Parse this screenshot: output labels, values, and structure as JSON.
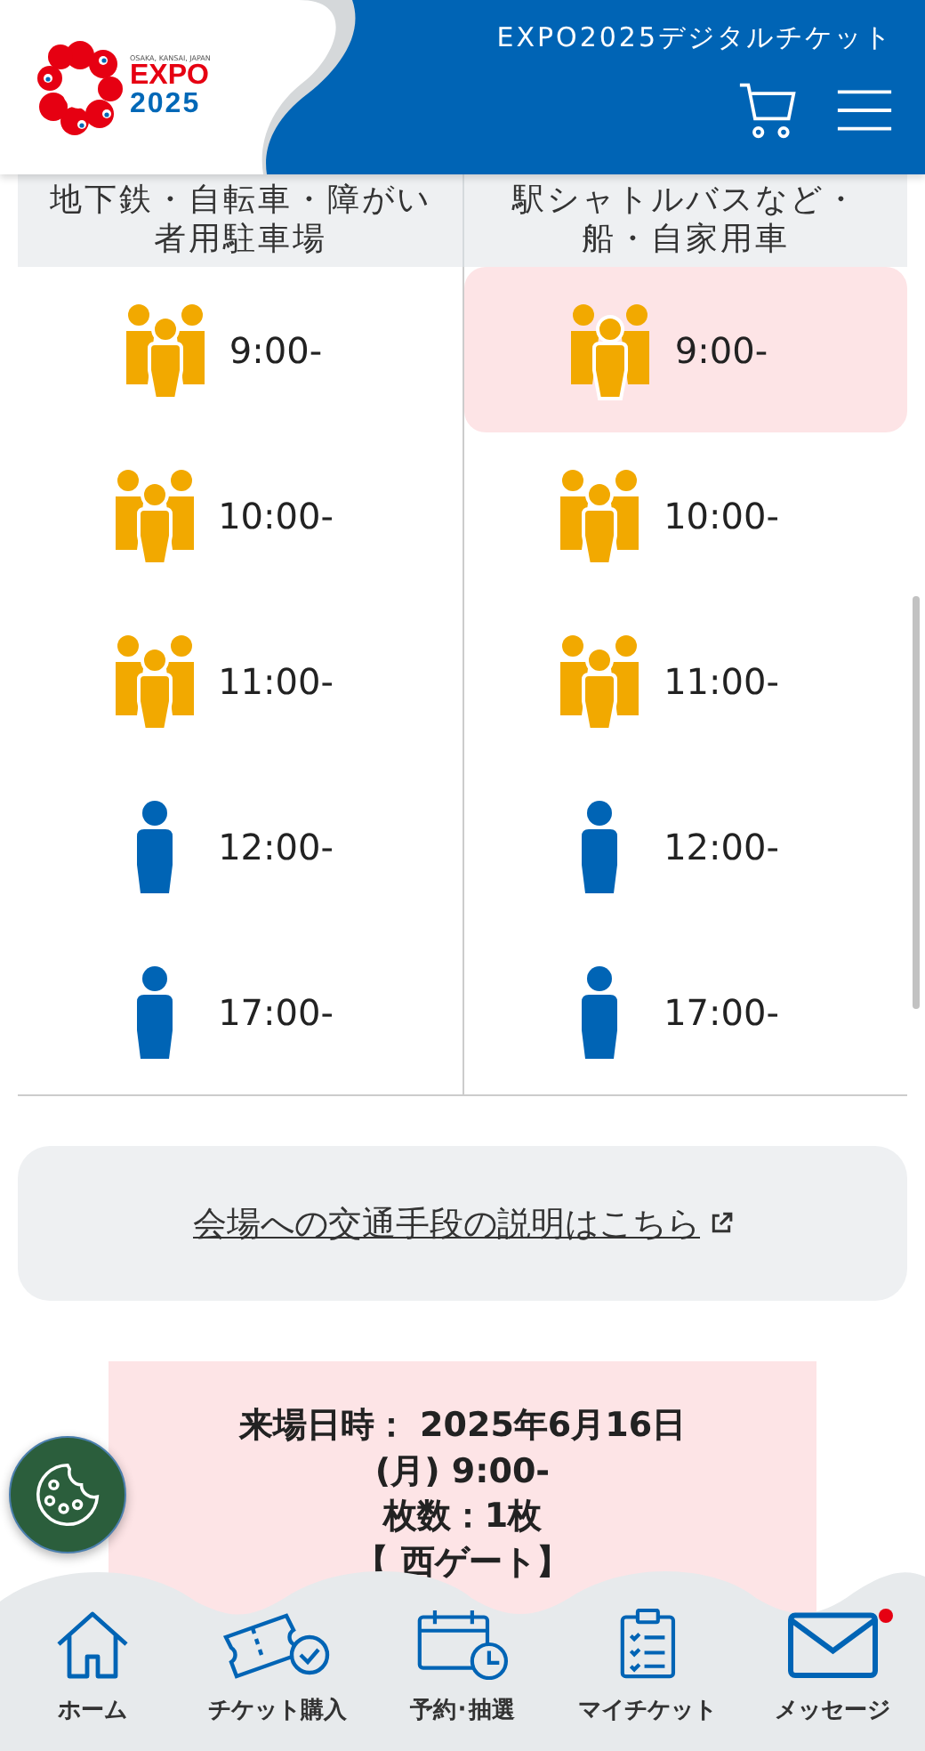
{
  "header": {
    "logo": {
      "tagline": "OSAKA, KANSAI, JAPAN",
      "word": "EXPO",
      "year": "2025"
    },
    "title": "EXPO2025デジタルチケット"
  },
  "table": {
    "columns": [
      "地下鉄・自転車・障がい者用駐車場",
      "駅シャトルバスなど・船・自家用車"
    ],
    "rows": [
      [
        {
          "time": "9:00-",
          "kind": "crowded",
          "selected": false
        },
        {
          "time": "9:00-",
          "kind": "crowded",
          "selected": true
        }
      ],
      [
        {
          "time": "10:00-",
          "kind": "crowded",
          "selected": false
        },
        {
          "time": "10:00-",
          "kind": "crowded",
          "selected": false
        }
      ],
      [
        {
          "time": "11:00-",
          "kind": "crowded",
          "selected": false
        },
        {
          "time": "11:00-",
          "kind": "crowded",
          "selected": false
        }
      ],
      [
        {
          "time": "12:00-",
          "kind": "few",
          "selected": false
        },
        {
          "time": "12:00-",
          "kind": "few",
          "selected": false
        }
      ],
      [
        {
          "time": "17:00-",
          "kind": "few",
          "selected": false
        },
        {
          "time": "17:00-",
          "kind": "few",
          "selected": false
        }
      ]
    ]
  },
  "access_link": "会場への交通手段の説明はこちら",
  "summary": {
    "date_time": "来場日時： 2025年6月16日 (月) 9:00-",
    "count": "枚数：1枚",
    "gate": "【 西ゲート】"
  },
  "bottom_nav": [
    {
      "kind": "home",
      "label": "ホーム",
      "badge": false
    },
    {
      "kind": "ticket",
      "label": "チケット購入",
      "badge": false
    },
    {
      "kind": "calendar",
      "label": "予約･抽選",
      "badge": false
    },
    {
      "kind": "clipboard",
      "label": "マイチケット",
      "badge": false
    },
    {
      "kind": "mail",
      "label": "メッセージ",
      "badge": true
    }
  ]
}
